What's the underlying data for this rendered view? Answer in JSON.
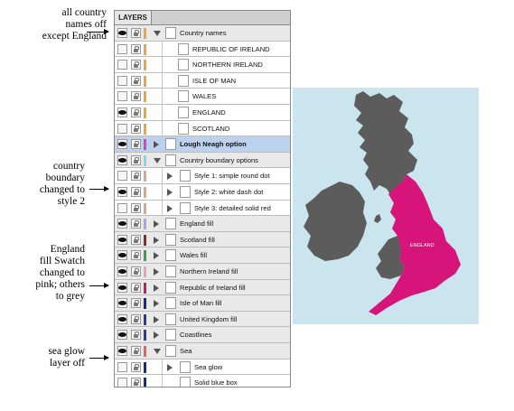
{
  "annotations": [
    {
      "name": "annotation-country-names",
      "lines": [
        "all country",
        "names off",
        "except England"
      ]
    },
    {
      "name": "annotation-country-boundary",
      "lines": [
        "country",
        "boundary",
        "changed to",
        "style 2"
      ]
    },
    {
      "name": "annotation-england-fill",
      "lines": [
        "England",
        "fill  Swatch",
        "changed to",
        "pink; others",
        "to grey"
      ]
    },
    {
      "name": "annotation-sea-glow",
      "lines": [
        "sea glow",
        "layer off"
      ]
    }
  ],
  "panel": {
    "tab_label": "LAYERS",
    "rows": [
      {
        "label": "Country names",
        "visible": true,
        "swatch": "#f2a33a",
        "expand": "open",
        "level": 0,
        "selected": false
      },
      {
        "label": "REPUBLIC OF IRELAND",
        "visible": false,
        "swatch": "#f2a33a",
        "expand": "none",
        "level": 2,
        "selected": false
      },
      {
        "label": "NORTHERN IRELAND",
        "visible": false,
        "swatch": "#f2a33a",
        "expand": "none",
        "level": 2,
        "selected": false
      },
      {
        "label": "ISLE OF MAN",
        "visible": false,
        "swatch": "#f2a33a",
        "expand": "none",
        "level": 2,
        "selected": false
      },
      {
        "label": "WALES",
        "visible": false,
        "swatch": "#f2a33a",
        "expand": "none",
        "level": 2,
        "selected": false
      },
      {
        "label": "ENGLAND",
        "visible": true,
        "swatch": "#f2a33a",
        "expand": "none",
        "level": 2,
        "selected": false
      },
      {
        "label": "SCOTLAND",
        "visible": false,
        "swatch": "#f2a33a",
        "expand": "none",
        "level": 2,
        "selected": false
      },
      {
        "label": "Lough Neagh option",
        "visible": true,
        "swatch": "#e040c8",
        "expand": "closed",
        "level": 0,
        "selected": true
      },
      {
        "label": "Country boundary options",
        "visible": true,
        "swatch": "#7fd8e8",
        "expand": "open",
        "level": 0,
        "selected": false
      },
      {
        "label": "Style 1: simple round dot",
        "visible": false,
        "swatch": "#d9a88a",
        "expand": "closed",
        "level": 1,
        "selected": false
      },
      {
        "label": "Style 2: white dash dot",
        "visible": true,
        "swatch": "#d9a88a",
        "expand": "closed",
        "level": 1,
        "selected": false
      },
      {
        "label": "Style 3: detailed solid red",
        "visible": false,
        "swatch": "#d9a88a",
        "expand": "closed",
        "level": 1,
        "selected": false
      },
      {
        "label": "England fill",
        "visible": true,
        "swatch": "#a8a4e8",
        "expand": "closed",
        "level": 0,
        "selected": false
      },
      {
        "label": "Scotland fill",
        "visible": true,
        "swatch": "#8a2a2a",
        "expand": "closed",
        "level": 0,
        "selected": false
      },
      {
        "label": "Wales fill",
        "visible": true,
        "swatch": "#3aa04a",
        "expand": "closed",
        "level": 0,
        "selected": false
      },
      {
        "label": "Northern Ireland fill",
        "visible": true,
        "swatch": "#f0a0b0",
        "expand": "closed",
        "level": 0,
        "selected": false
      },
      {
        "label": "Republic of Ireland fill",
        "visible": true,
        "swatch": "#c02060",
        "expand": "closed",
        "level": 0,
        "selected": false
      },
      {
        "label": "Isle of Man fill",
        "visible": true,
        "swatch": "#1a2a8a",
        "expand": "closed",
        "level": 0,
        "selected": false
      },
      {
        "label": "United Kingdom fill",
        "visible": true,
        "swatch": "#2a3aa0",
        "expand": "closed",
        "level": 0,
        "selected": false
      },
      {
        "label": "Coastlines",
        "visible": true,
        "swatch": "#2a3aa0",
        "expand": "closed",
        "level": 0,
        "selected": false
      },
      {
        "label": "Sea",
        "visible": true,
        "swatch": "#e86060",
        "expand": "open",
        "level": 0,
        "selected": false
      },
      {
        "label": "Sea glow",
        "visible": false,
        "swatch": "#1a2a8a",
        "expand": "closed",
        "level": 1,
        "selected": false
      },
      {
        "label": "Solid blue box",
        "visible": false,
        "swatch": "#1a2a8a",
        "expand": "none",
        "level": 1,
        "selected": false
      }
    ]
  },
  "map": {
    "england_label": "ENGLAND",
    "colors": {
      "sea": "#cbe5ee",
      "england": "#d6147a",
      "other_land": "#5c5c5c"
    }
  }
}
